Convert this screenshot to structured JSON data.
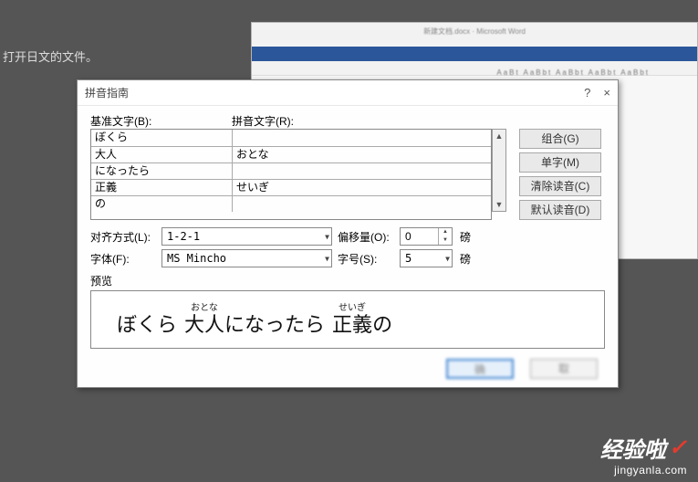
{
  "background": {
    "partial_text": "打开日文的文件。",
    "word_title": "新建文档.docx · Microsoft Word",
    "ribbon_styles": "AaBt AaBbt AaBbt AaBbt AaBbt"
  },
  "dialog": {
    "title": "拼音指南",
    "help_icon": "?",
    "close_icon": "×",
    "labels": {
      "base": "基准文字(B):",
      "ruby": "拼音文字(R):",
      "align": "对齐方式(L):",
      "offset": "偏移量(O):",
      "font": "字体(F):",
      "size": "字号(S):",
      "preview": "预览",
      "unit_point": "磅"
    },
    "rows": [
      {
        "base": "ぼくら",
        "ruby": ""
      },
      {
        "base": "大人",
        "ruby": "おとな"
      },
      {
        "base": "になったら",
        "ruby": ""
      },
      {
        "base": "正義",
        "ruby": "せいぎ"
      },
      {
        "base": "の",
        "ruby": ""
      }
    ],
    "buttons": {
      "combine": "组合(G)",
      "single": "单字(M)",
      "clear": "清除读音(C)",
      "default_reading": "默认读音(D)",
      "ok": "确",
      "cancel": "取"
    },
    "values": {
      "align": "1-2-1",
      "offset": "0",
      "font": "MS Mincho",
      "size": "5"
    },
    "preview_items": [
      {
        "rb": "ぼくら",
        "rt": ""
      },
      {
        "rb": "大人",
        "rt": "おとな"
      },
      {
        "rb": "になったら",
        "rt": ""
      },
      {
        "rb": "正義",
        "rt": "せいぎ"
      },
      {
        "rb": "の",
        "rt": ""
      }
    ]
  },
  "watermark": {
    "brand": "经验啦",
    "check": "✓",
    "url": "jingyanla.com"
  }
}
